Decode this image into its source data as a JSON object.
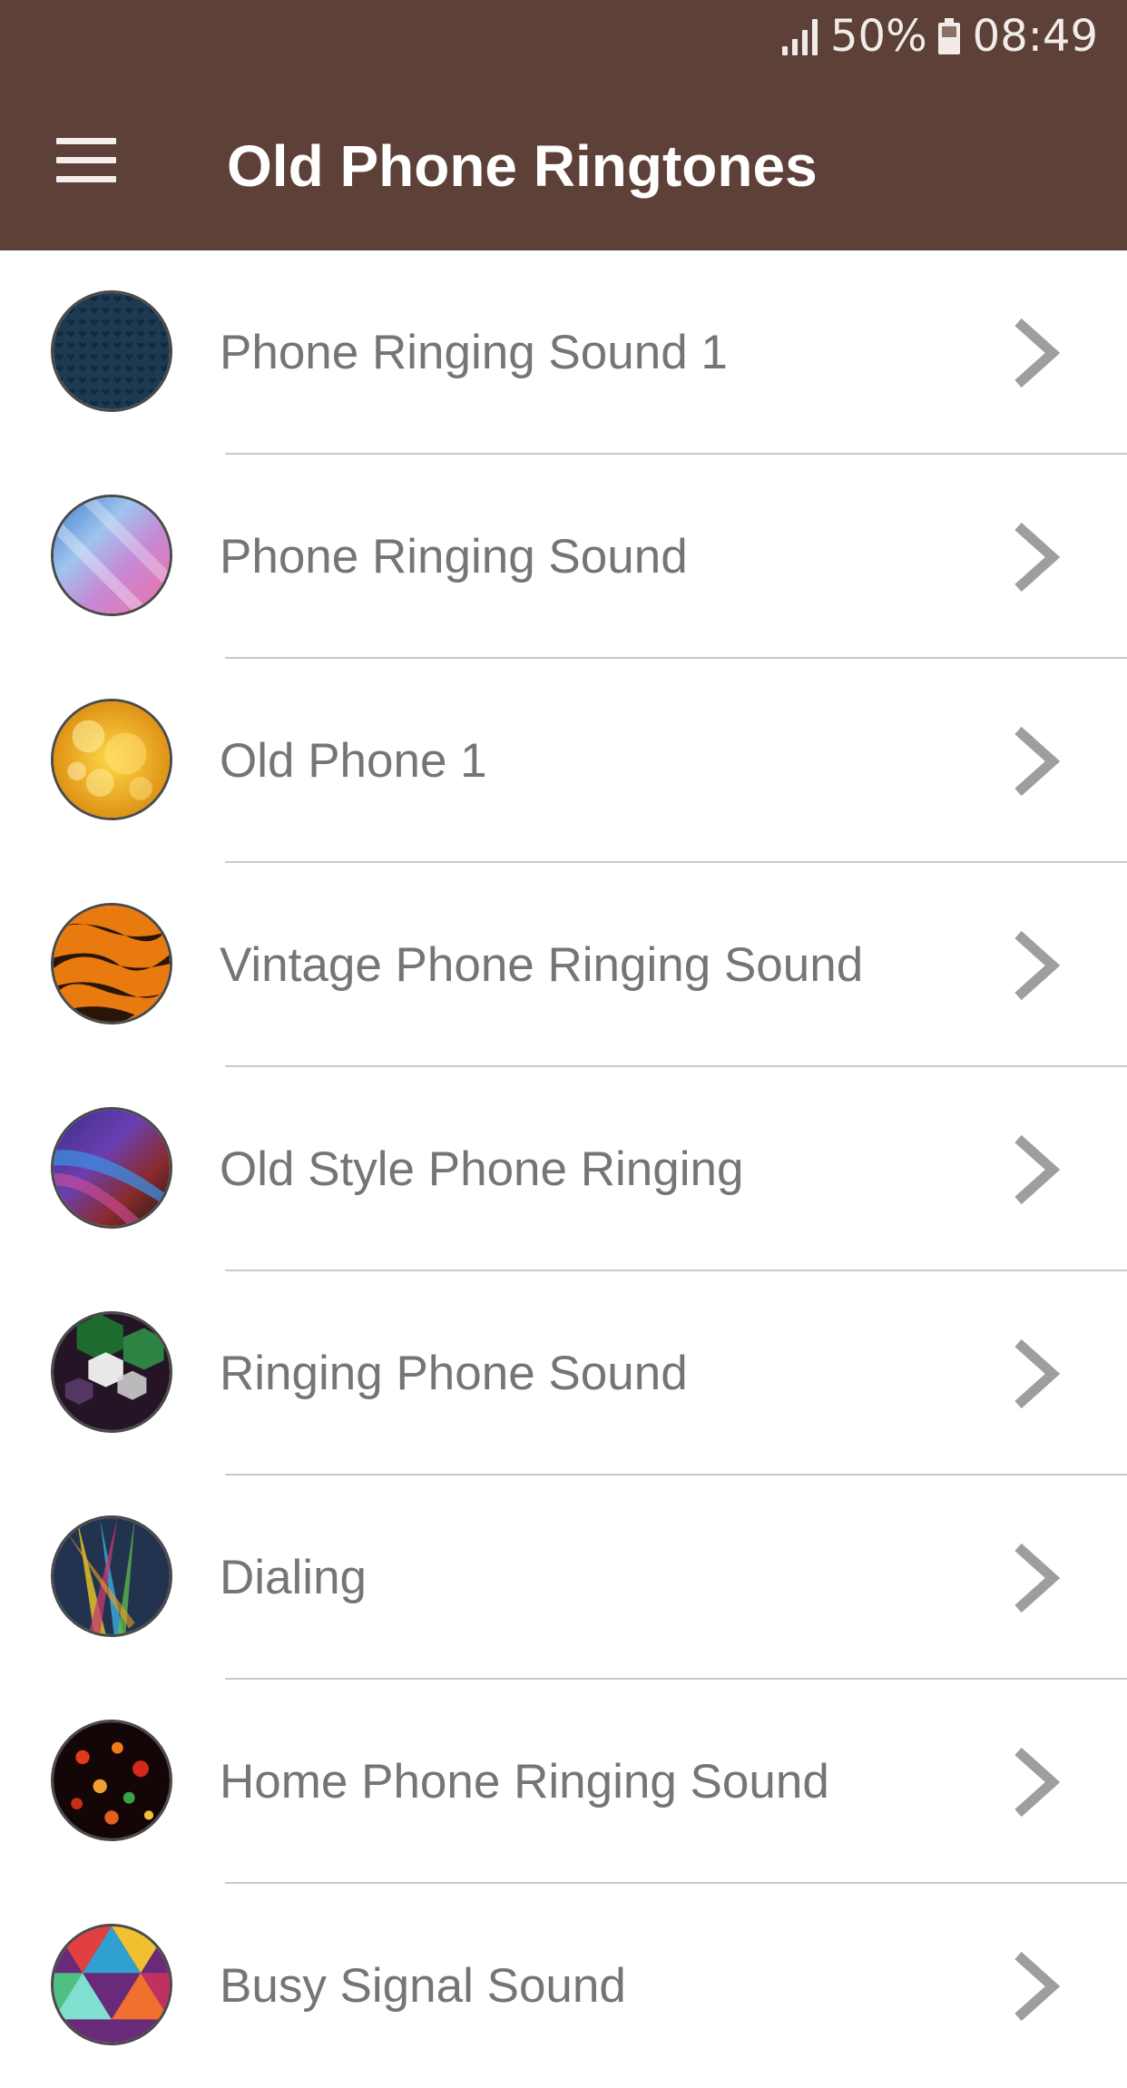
{
  "status_bar": {
    "battery_percent": "50%",
    "time": "08:49",
    "signal_icon": "signal-icon",
    "battery_icon": "battery-icon"
  },
  "header": {
    "menu_icon": "hamburger-menu-icon",
    "title": "Old Phone Ringtones",
    "background_color": "#5d4037"
  },
  "ringtones": [
    {
      "label": "Phone Ringing Sound 1"
    },
    {
      "label": "Phone Ringing Sound"
    },
    {
      "label": "Old Phone 1"
    },
    {
      "label": "Vintage Phone Ringing Sound"
    },
    {
      "label": "Old Style Phone Ringing"
    },
    {
      "label": "Ringing Phone Sound"
    },
    {
      "label": "Dialing"
    },
    {
      "label": "Home Phone Ringing Sound"
    },
    {
      "label": "Busy Signal Sound"
    }
  ],
  "colors": {
    "header": "#5d4037",
    "label_text": "#757575",
    "chevron": "#9e9e9e",
    "divider": "#c9c9c9"
  }
}
